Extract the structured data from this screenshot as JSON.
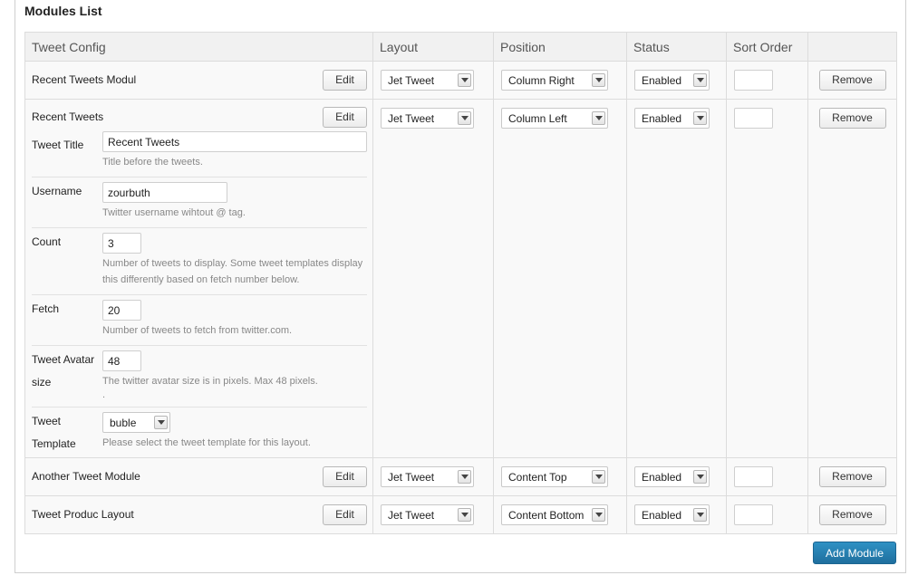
{
  "panel": {
    "title": "Modules List"
  },
  "table": {
    "headers": {
      "config": "Tweet Config",
      "layout": "Layout",
      "position": "Position",
      "status": "Status",
      "sort": "Sort Order"
    }
  },
  "buttons": {
    "edit": "Edit",
    "remove": "Remove",
    "add_module": "Add Module"
  },
  "modules": [
    {
      "name": "Recent Tweets Modul",
      "layout": "Jet Tweet",
      "position": "Column Right",
      "status": "Enabled",
      "sort_order": ""
    },
    {
      "name": "Recent Tweets",
      "layout": "Jet Tweet",
      "position": "Column Left",
      "status": "Enabled",
      "sort_order": ""
    },
    {
      "name": "Another Tweet Module",
      "layout": "Jet Tweet",
      "position": "Content Top",
      "status": "Enabled",
      "sort_order": ""
    },
    {
      "name": "Tweet Produc Layout",
      "layout": "Jet Tweet",
      "position": "Content Bottom",
      "status": "Enabled",
      "sort_order": ""
    }
  ],
  "config_fields": {
    "title": {
      "label": "Tweet Title",
      "value": "Recent Tweets",
      "hint": "Title before the tweets."
    },
    "username": {
      "label": "Username",
      "value": "zourbuth",
      "hint": "Twitter username wihtout @ tag."
    },
    "count": {
      "label": "Count",
      "value": "3",
      "hint": "Number of tweets to display. Some tweet templates display this differently based on fetch number below."
    },
    "fetch": {
      "label": "Fetch",
      "value": "20",
      "hint": "Number of tweets to fetch from twitter.com."
    },
    "avatar": {
      "label": "Tweet Avatar size",
      "value": "48",
      "hint": "The twitter avatar size is in pixels. Max 48 pixels.",
      "hint_extra": "."
    },
    "template": {
      "label": "Tweet Template",
      "value": "buble",
      "hint": "Please select the tweet template for this layout."
    }
  },
  "icons": {
    "select_arrow": "chevron-down-icon"
  }
}
